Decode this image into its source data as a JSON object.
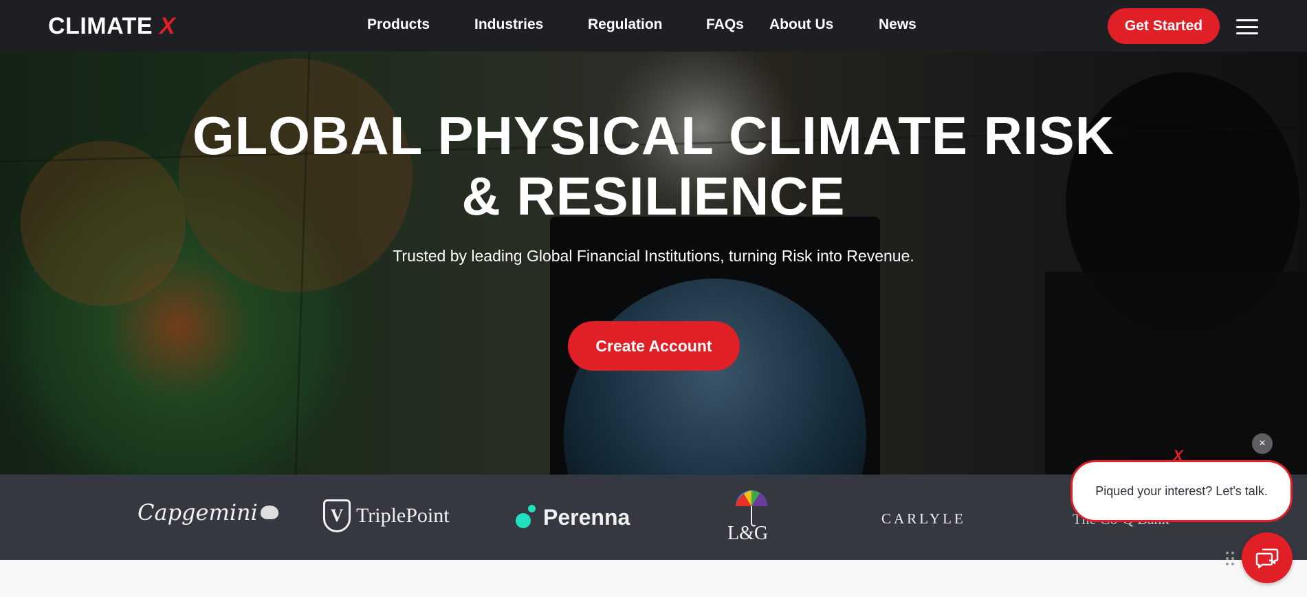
{
  "brand": {
    "name": "CLIMATE",
    "mark": "X"
  },
  "nav": {
    "items": [
      "Products",
      "Industries",
      "Regulation",
      "FAQs",
      "About Us",
      "News"
    ],
    "cta_label": "Get Started"
  },
  "hero": {
    "title_line1": "GLOBAL PHYSICAL CLIMATE RISK",
    "title_line2": "& RESILIENCE",
    "subtitle": "Trusted by leading Global Financial Institutions, turning Risk into Revenue.",
    "cta_label": "Create Account"
  },
  "clients": [
    "Capgemini",
    "TriplePoint",
    "Perenna",
    "L&G",
    "CARLYLE",
    "The Co-Q Bank"
  ],
  "chat": {
    "close_label": "×",
    "brand_mark": "X",
    "prompt": "Piqued your interest? Let's talk."
  },
  "colors": {
    "accent": "#e01f26",
    "nav_bg": "#1d1f23",
    "logo_strip_bg": "#353840",
    "perenna_dot": "#21e0c0"
  },
  "icons": [
    "hamburger-menu-icon",
    "chat-icon",
    "close-icon",
    "drag-grip-icon"
  ]
}
